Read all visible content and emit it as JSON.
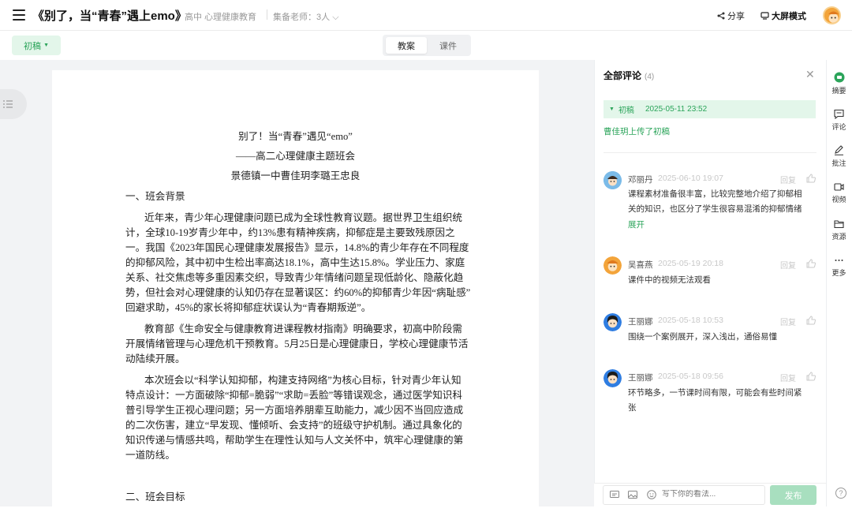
{
  "header": {
    "title": "《别了，当“青春”遇上emo》",
    "grade_subject": "高中 心理健康教育",
    "coteachers": "集备老师：3人",
    "share_label": "分享",
    "bigscreen_label": "大屏模式"
  },
  "toolbar": {
    "version_label": "初稿",
    "tabs": [
      "教案",
      "课件"
    ],
    "active_tab": "教案"
  },
  "document": {
    "title": "别了！当“青春”遇见“emo”",
    "subtitle": "——高二心理健康主题班会",
    "authors": "景德镇一中曹佳玥李璐王忠良",
    "section1_heading": "一、班会背景",
    "p1": [
      "近年来，青少年心理健康问题已成为全球性教育议题。据世界卫生组织统",
      "计，全球10-19岁青少年中，约13%患有精神疾病，抑郁症是主要致残原因之",
      "一。我国《2023年国民心理健康发展报告》显示，14.8%的青少年存在不同程度",
      "的抑郁风险，其中初中生检出率高达18.1%，高中生达15.8%。学业压力、家庭",
      "关系、社交焦虑等多重因素交织，导致青少年情绪问题呈现低龄化、隐蔽化趋",
      "势，但社会对心理健康的认知仍存在显著误区：约60%的抑郁青少年因“病耻感”",
      "回避求助，45%的家长将抑郁症状误认为“青春期叛逆”。"
    ],
    "p2": [
      "教育部《生命安全与健康教育进课程教材指南》明确要求，初高中阶段需",
      "开展情绪管理与心理危机干预教育。5月25日是心理健康日，学校心理健康节活",
      "动陆续开展。"
    ],
    "p3": [
      "本次班会以“科学认知抑郁，构建支持网络”为核心目标，针对青少年认知",
      "特点设计：一方面破除“抑郁=脆弱”“求助=丢脸”等错误观念，通过医学知识科",
      "普引导学生正视心理问题；另一方面培养朋辈互助能力，减少因不当回应造成",
      "的二次伤害，建立“早发现、懂倾听、会支持”的班级守护机制。通过具象化的",
      "知识传递与情感共鸣，帮助学生在理性认知与人文关怀中，筑牢心理健康的第",
      "一道防线。"
    ],
    "section2_heading": "二、班会目标"
  },
  "comments_panel": {
    "title": "全部评论",
    "count": "(4)",
    "draft_label": "初稿",
    "draft_date": "2025-05-11 23:52",
    "upload_note": "曹佳玥上传了初稿",
    "reply_label": "回复",
    "expand_label": "展开",
    "comments": [
      {
        "author": "邓丽丹",
        "time": "2025-06-10 19:07",
        "lines": [
          "课程素材准备很丰富，比较完整地介绍了抑郁相",
          "关的知识，也区分了学生很容易混淆的抑郁情绪"
        ]
      },
      {
        "author": "吴喜燕",
        "time": "2025-05-19 20:18",
        "lines": [
          "课件中的视频无法观看"
        ]
      },
      {
        "author": "王丽娜",
        "time": "2025-05-18 10:53",
        "lines": [
          "围绕一个案例展开，深入浅出，通俗易懂"
        ]
      },
      {
        "author": "王丽娜",
        "time": "2025-05-18 09:56",
        "lines": [
          "环节略多，一节课时间有限，可能会有些时间紧",
          "张"
        ]
      }
    ],
    "input_placeholder": "写下你的看法...",
    "publish_label": "发布"
  },
  "rail": {
    "items": [
      "摘要",
      "评论",
      "批注",
      "视频",
      "资源",
      "更多"
    ]
  },
  "help_label": "?",
  "colors": {
    "accent": "#2ba45a",
    "accent_light": "#e3f6ea"
  }
}
